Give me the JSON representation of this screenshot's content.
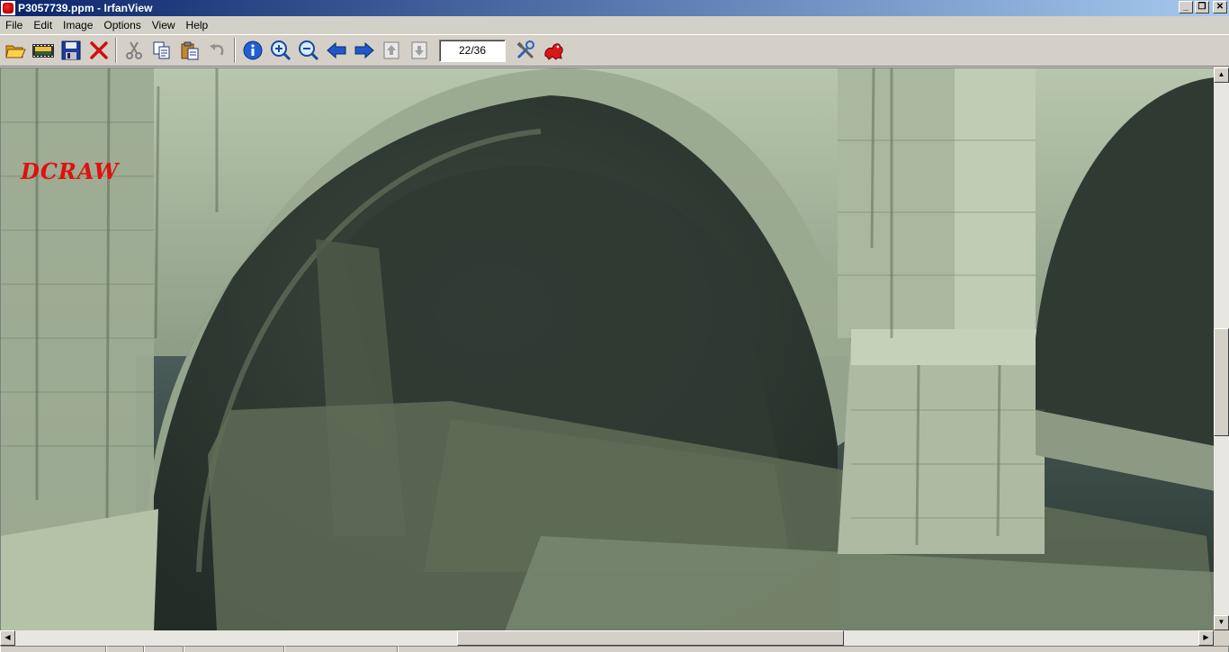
{
  "window": {
    "title": "P3057739.ppm - IrfanView",
    "buttons": [
      "minimize",
      "restore",
      "close"
    ]
  },
  "menu": {
    "items": [
      {
        "label": "File"
      },
      {
        "label": "Edit"
      },
      {
        "label": "Image"
      },
      {
        "label": "Options"
      },
      {
        "label": "View"
      },
      {
        "label": "Help"
      }
    ]
  },
  "toolbar": {
    "icons": [
      "open-folder-icon",
      "slideshow-icon",
      "save-icon",
      "delete-icon",
      "cut-icon",
      "copy-icon",
      "paste-icon",
      "undo-icon",
      "info-icon",
      "zoom-in-icon",
      "zoom-out-icon",
      "previous-icon",
      "next-icon",
      "first-page-icon",
      "last-page-icon",
      "properties-icon",
      "irfanview-logo-icon"
    ],
    "page_counter": "22/36"
  },
  "image": {
    "overlay_text": "DCRAW"
  },
  "colors": {
    "titlebar_start": "#0a246a",
    "titlebar_end": "#a6caf0",
    "window_bg": "#d4d0c8",
    "overlay_text": "#e01010"
  }
}
